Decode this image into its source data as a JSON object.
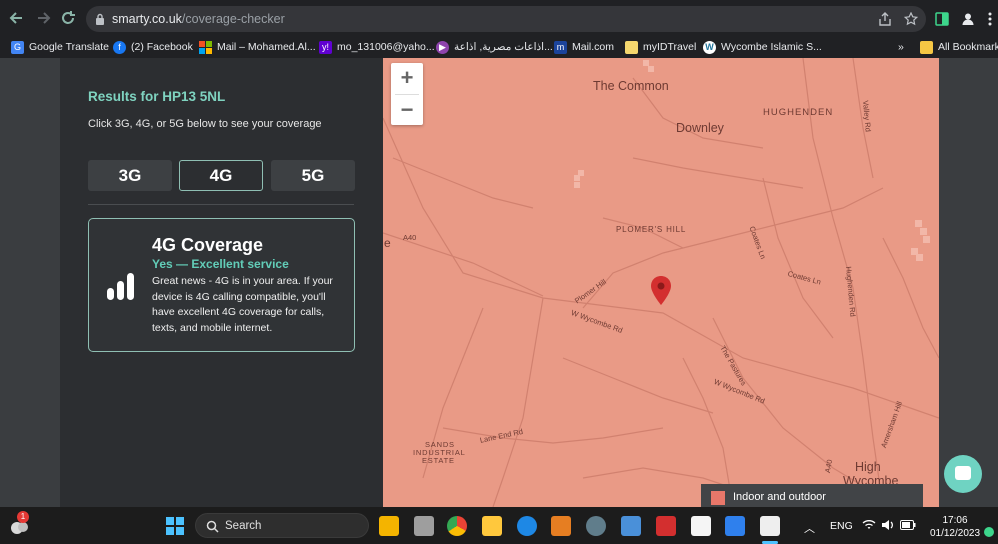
{
  "browser": {
    "url_domain": "smarty.co.uk",
    "url_path": "/coverage-checker",
    "bookmarks": [
      {
        "label": "Google Translate",
        "icon": "google-translate-icon"
      },
      {
        "label": "(2) Facebook",
        "icon": "facebook-icon"
      },
      {
        "label": "Mail – Mohamed.Al...",
        "icon": "microsoft-icon"
      },
      {
        "label": "mo_131006@yaho...",
        "icon": "yahoo-icon"
      },
      {
        "label": "اذاعات مصرية, اذاعة...",
        "icon": "radio-icon"
      },
      {
        "label": "Mail.com",
        "icon": "mailcom-icon"
      },
      {
        "label": "myIDTravel",
        "icon": "myidtravel-icon"
      },
      {
        "label": "Wycombe Islamic S...",
        "icon": "wordpress-icon"
      }
    ],
    "more_bookmarks": "»",
    "all_bookmarks": "All Bookmarks"
  },
  "coverage": {
    "results_title": "Results for HP13 5NL",
    "instructions": "Click 3G, 4G, or 5G below to see your coverage",
    "tabs": [
      "3G",
      "4G",
      "5G"
    ],
    "selected_tab": "4G",
    "card": {
      "title": "4G Coverage",
      "status": "Yes — Excellent service",
      "body": "Great news - 4G is in your area. If your device is 4G calling compatible, you'll have excellent 4G coverage for calls, texts, and mobile internet."
    }
  },
  "map": {
    "zoom_in": "+",
    "zoom_out": "−",
    "labels": {
      "the_common": "The Common",
      "downley": "Downley",
      "hughenden": "HUGHENDEN",
      "plomers_hill": "PLOMER'S HILL",
      "a40_left": "A40",
      "e_edge": "e",
      "coates_ln": "Coates Ln",
      "coates_ln_2": "Coates Ln",
      "hughenden_rd": "Hughenden Rd",
      "valley_rd": "Valley Rd",
      "plomer_hill": "Plomer Hill",
      "w_wycombe_rd": "W Wycombe Rd",
      "w_wycombe_rd_2": "W Wycombe Rd",
      "the_pastures": "The Pastures",
      "lane_end_rd": "Lane End Rd",
      "sands": "SANDS",
      "industrial": "INDUSTRIAL",
      "estate": "ESTATE",
      "amersham_hill": "Amersham Hill",
      "a40_right": "A40",
      "high": "High",
      "wycombe": "Wycombe"
    },
    "legend_label": "Indoor and outdoor",
    "coverage_color": "#e99a86",
    "legend_color": "#e8776a"
  },
  "taskbar": {
    "search_label": "Search",
    "language": "ENG",
    "time": "17:06",
    "date": "01/12/2023",
    "notification_badge": "1"
  },
  "colors": {
    "accent_teal": "#7fd3c0",
    "panel_bg": "#2c2e31",
    "pin_red": "#d32f2f"
  }
}
